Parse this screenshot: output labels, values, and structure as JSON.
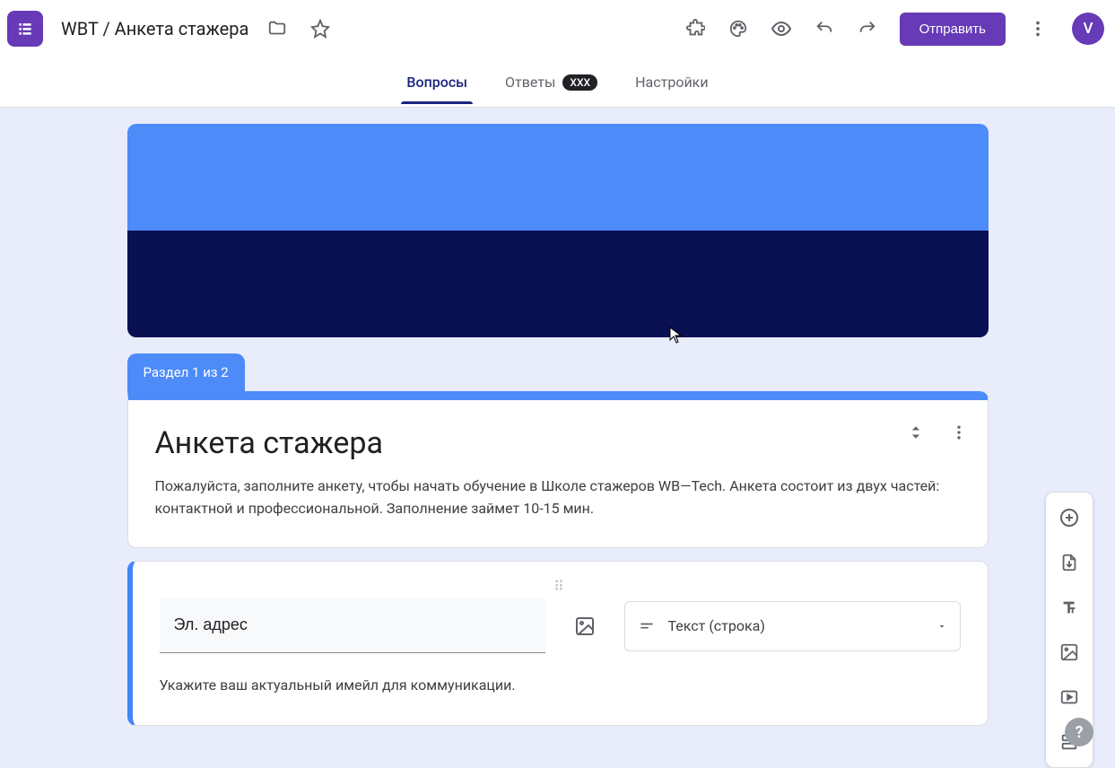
{
  "header": {
    "doc_title": "WBT / Анкета стажера",
    "send_label": "Отправить",
    "avatar_letter": "V"
  },
  "tabs": {
    "questions": "Вопросы",
    "responses": "Ответы",
    "responses_count": "XXX",
    "settings": "Настройки"
  },
  "section_label": "Раздел 1 из 2",
  "form": {
    "title": "Анкета стажера",
    "description": "Пожалуйста, заполните анкету, чтобы начать обучение в Школе стажеров WB—Tech. Анкета состоит из двух частей: контактной и профессиональной. Заполнение займет 10-15 мин."
  },
  "question": {
    "title": "Эл. адрес",
    "description": "Укажите ваш актуальный имейл для коммуникации.",
    "type_label": "Текст (строка)"
  },
  "colors": {
    "accent": "#673ab7",
    "form_accent": "#4d8bf9"
  }
}
